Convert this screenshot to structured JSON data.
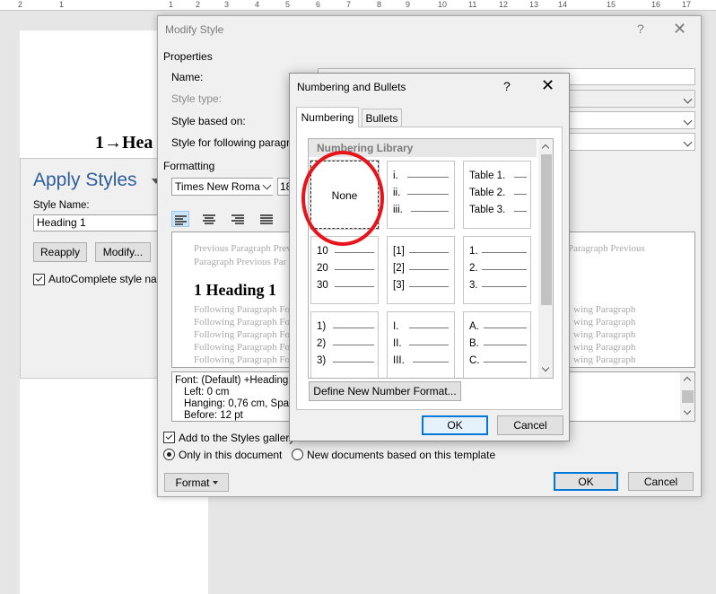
{
  "ruler": {
    "ticks": [
      "2",
      "1",
      "1",
      "2",
      "3",
      "4",
      "5",
      "6",
      "7",
      "8",
      "9",
      "10",
      "11",
      "12",
      "13",
      "14",
      "15",
      "16",
      "17"
    ]
  },
  "document": {
    "heading_text": "1→Hea"
  },
  "apply_styles": {
    "title": "Apply Styles",
    "style_name_label": "Style Name:",
    "style_name_value": "Heading 1",
    "reapply_label": "Reapply",
    "modify_label": "Modify...",
    "autocomplete_label": "AutoComplete style nam",
    "autocomplete_checked": true
  },
  "modify_style": {
    "title": "Modify Style",
    "help": "?",
    "close": "✕",
    "properties_label": "Properties",
    "name_label": "Name:",
    "style_type_label": "Style type:",
    "based_on_label": "Style based on:",
    "following_label": "Style for following paragr",
    "formatting_label": "Formatting",
    "font_name": "Times New Roman",
    "font_size": "18",
    "preview": {
      "prev_lines": [
        "Previous Paragraph Previ",
        "Paragraph Previous Par"
      ],
      "prev_lines_right": [
        "Paragraph Previous"
      ],
      "heading": "1   Heading 1",
      "following_lines": [
        "Following Paragraph Fo",
        "Following Paragraph Fo",
        "Following Paragraph Fo",
        "Following Paragraph Fo",
        "Following Paragraph Fo"
      ],
      "following_lines_right": [
        "wing Paragraph",
        "wing Paragraph",
        "wing Paragraph",
        "wing Paragraph",
        "wing Paragraph"
      ]
    },
    "description": [
      "Font: (Default) +Heading",
      "Left:  0 cm",
      "Hanging:  0,76 cm, Spa",
      "Before:  12 pt"
    ],
    "add_gallery_label": "Add to the Styles gallery",
    "only_doc_label": "Only in this document",
    "new_docs_label": "New documents based on this template",
    "format_label": "Format",
    "ok_label": "OK",
    "cancel_label": "Cancel"
  },
  "numbering_bullets": {
    "title": "Numbering and Bullets",
    "help": "?",
    "close": "✕",
    "tab_numbering": "Numbering",
    "tab_bullets": "Bullets",
    "library_label": "Numbering Library",
    "none_label": "None",
    "cells": [
      [
        "i.",
        "ii.",
        "iii."
      ],
      [
        "Table 1.",
        "Table 2.",
        "Table 3."
      ],
      [
        "10",
        "20",
        "30"
      ],
      [
        "[1]",
        "[2]",
        "[3]"
      ],
      [
        "1.",
        "2.",
        "3."
      ],
      [
        "1)",
        "2)",
        "3)"
      ],
      [
        "I.",
        "II.",
        "III."
      ],
      [
        "A.",
        "B.",
        "C."
      ]
    ],
    "define_label": "Define New Number Format...",
    "ok_label": "OK",
    "cancel_label": "Cancel"
  },
  "colors": {
    "annotation": "#e8141c",
    "accent": "#0078d7",
    "pane_title": "#2e5e9c"
  }
}
